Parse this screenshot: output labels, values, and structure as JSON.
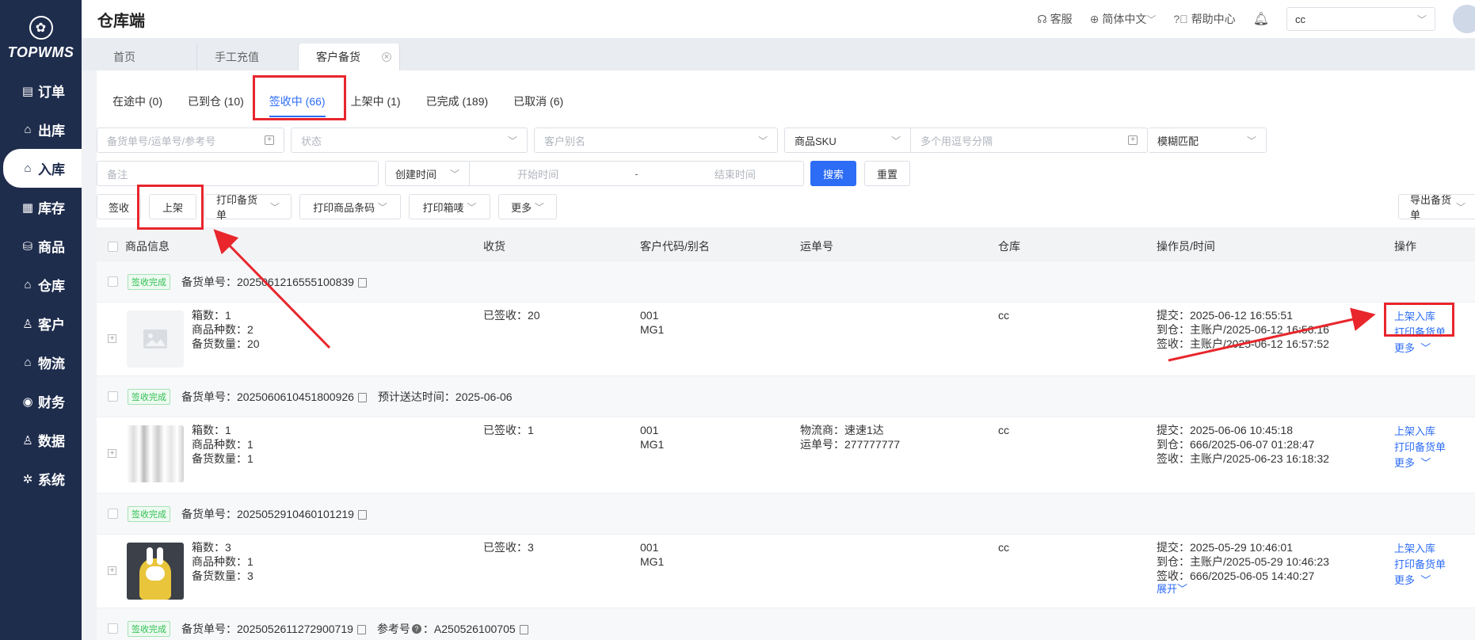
{
  "app": {
    "logo_mark": "✿",
    "logo_text": "TOPWMS",
    "title": "仓库端"
  },
  "sidebar": {
    "items": [
      {
        "label": "订单",
        "icon": "order-icon",
        "glyph": "▤"
      },
      {
        "label": "出库",
        "icon": "outbound-icon",
        "glyph": "⌂"
      },
      {
        "label": "入库",
        "icon": "inbound-icon",
        "glyph": "⌂"
      },
      {
        "label": "库存",
        "icon": "inventory-icon",
        "glyph": "▦"
      },
      {
        "label": "商品",
        "icon": "product-icon",
        "glyph": "⛁"
      },
      {
        "label": "仓库",
        "icon": "warehouse-icon",
        "glyph": "⌂"
      },
      {
        "label": "客户",
        "icon": "customer-icon",
        "glyph": "♙"
      },
      {
        "label": "物流",
        "icon": "logistics-icon",
        "glyph": "⌂"
      },
      {
        "label": "财务",
        "icon": "finance-icon",
        "glyph": "◉"
      },
      {
        "label": "数据",
        "icon": "data-icon",
        "glyph": "♙"
      },
      {
        "label": "系统",
        "icon": "system-icon",
        "glyph": "✲"
      }
    ],
    "active_index": 2
  },
  "header": {
    "service": "客服",
    "language": "简体中文",
    "help": "帮助中心",
    "warehouse_select": "cc"
  },
  "page_tabs": [
    {
      "label": "首页"
    },
    {
      "label": "手工充值"
    },
    {
      "label": "客户备货"
    }
  ],
  "status_tabs": [
    {
      "label": "在途中 (0)"
    },
    {
      "label": "已到仓 (10)"
    },
    {
      "label": "签收中 (66)"
    },
    {
      "label": "上架中 (1)"
    },
    {
      "label": "已完成 (189)"
    },
    {
      "label": "已取消 (6)"
    }
  ],
  "filters": {
    "order_no_placeholder": "备货单号/运单号/参考号",
    "status_placeholder": "状态",
    "customer_alias_placeholder": "客户别名",
    "sku_select": "商品SKU",
    "sku_placeholder": "多个用逗号分隔",
    "match_select": "模糊匹配",
    "remark_placeholder": "备注",
    "time_select": "创建时间",
    "start_placeholder": "开始时间",
    "time_sep": "-",
    "end_placeholder": "结束时间",
    "search_btn": "搜索",
    "reset_btn": "重置"
  },
  "actions": {
    "sign": "签收",
    "shelve": "上架",
    "print_order": "打印备货单",
    "print_barcode": "打印商品条码",
    "print_box": "打印箱唛",
    "more": "更多",
    "export": "导出备货单"
  },
  "table": {
    "headers": [
      "商品信息",
      "收货",
      "客户代码/别名",
      "运单号",
      "仓库",
      "操作员/时间",
      "操作"
    ],
    "groups": [
      {
        "status": "签收完成",
        "order_label": "备货单号：",
        "order_no": "2025061216555100839",
        "extra": "",
        "boxes": "箱数：1",
        "kinds": "商品种数：2",
        "qty": "备货数量：20",
        "received": "已签收：20",
        "cust_code": "001",
        "cust_alias": "MG1",
        "carrier": "",
        "tracking": "",
        "warehouse": "cc",
        "submit": "提交：2025-06-12 16:55:51",
        "arrive": "到仓：主账户/2025-06-12 16:56:16",
        "signed": "签收：主账户/2025-06-12 16:57:52",
        "expand": "",
        "op1": "上架入库",
        "op2": "打印备货单",
        "op3": "更多"
      },
      {
        "status": "签收完成",
        "order_label": "备货单号：",
        "order_no": "2025060610451800926",
        "extra": "预计送达时间：2025-06-06",
        "boxes": "箱数：1",
        "kinds": "商品种数：1",
        "qty": "备货数量：1",
        "received": "已签收：1",
        "cust_code": "001",
        "cust_alias": "MG1",
        "carrier": "物流商：速速1达",
        "tracking": "运单号：277777777",
        "warehouse": "cc",
        "submit": "提交：2025-06-06 10:45:18",
        "arrive": "到仓：666/2025-06-07 01:28:47",
        "signed": "签收：主账户/2025-06-23 16:18:32",
        "expand": "",
        "op1": "上架入库",
        "op2": "打印备货单",
        "op3": "更多"
      },
      {
        "status": "签收完成",
        "order_label": "备货单号：",
        "order_no": "2025052910460101219",
        "extra": "",
        "boxes": "箱数：3",
        "kinds": "商品种数：1",
        "qty": "备货数量：3",
        "received": "已签收：3",
        "cust_code": "001",
        "cust_alias": "MG1",
        "carrier": "",
        "tracking": "",
        "warehouse": "cc",
        "submit": "提交：2025-05-29 10:46:01",
        "arrive": "到仓：主账户/2025-05-29 10:46:23",
        "signed": "签收：666/2025-06-05 14:40:27",
        "expand": "展开",
        "op1": "上架入库",
        "op2": "打印备货单",
        "op3": "更多"
      },
      {
        "status": "签收完成",
        "order_label": "备货单号：",
        "order_no": "2025052611272900719",
        "extra": "参考号",
        "ref_no": "：A250526100705"
      }
    ]
  },
  "colors": {
    "primary": "#2d6cf5",
    "sidebar": "#1f2d4d",
    "annotation_red": "#e8262c",
    "success": "#2fbf52"
  }
}
